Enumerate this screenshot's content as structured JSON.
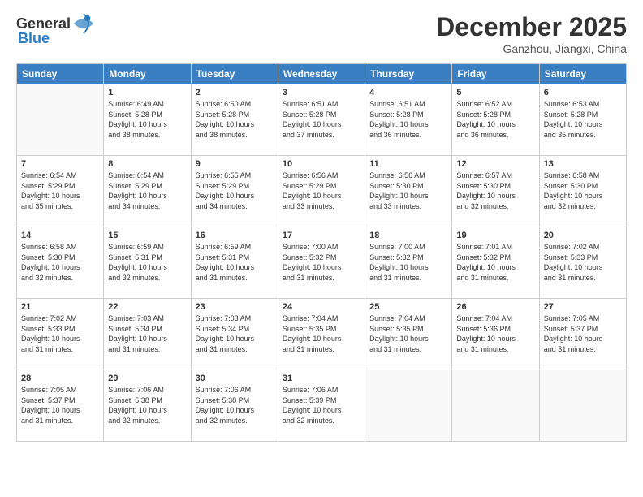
{
  "header": {
    "logo_general": "General",
    "logo_blue": "Blue",
    "month": "December 2025",
    "location": "Ganzhou, Jiangxi, China"
  },
  "days_of_week": [
    "Sunday",
    "Monday",
    "Tuesday",
    "Wednesday",
    "Thursday",
    "Friday",
    "Saturday"
  ],
  "weeks": [
    [
      {
        "day": "",
        "info": ""
      },
      {
        "day": "1",
        "info": "Sunrise: 6:49 AM\nSunset: 5:28 PM\nDaylight: 10 hours\nand 38 minutes."
      },
      {
        "day": "2",
        "info": "Sunrise: 6:50 AM\nSunset: 5:28 PM\nDaylight: 10 hours\nand 38 minutes."
      },
      {
        "day": "3",
        "info": "Sunrise: 6:51 AM\nSunset: 5:28 PM\nDaylight: 10 hours\nand 37 minutes."
      },
      {
        "day": "4",
        "info": "Sunrise: 6:51 AM\nSunset: 5:28 PM\nDaylight: 10 hours\nand 36 minutes."
      },
      {
        "day": "5",
        "info": "Sunrise: 6:52 AM\nSunset: 5:28 PM\nDaylight: 10 hours\nand 36 minutes."
      },
      {
        "day": "6",
        "info": "Sunrise: 6:53 AM\nSunset: 5:28 PM\nDaylight: 10 hours\nand 35 minutes."
      }
    ],
    [
      {
        "day": "7",
        "info": "Sunrise: 6:54 AM\nSunset: 5:29 PM\nDaylight: 10 hours\nand 35 minutes."
      },
      {
        "day": "8",
        "info": "Sunrise: 6:54 AM\nSunset: 5:29 PM\nDaylight: 10 hours\nand 34 minutes."
      },
      {
        "day": "9",
        "info": "Sunrise: 6:55 AM\nSunset: 5:29 PM\nDaylight: 10 hours\nand 34 minutes."
      },
      {
        "day": "10",
        "info": "Sunrise: 6:56 AM\nSunset: 5:29 PM\nDaylight: 10 hours\nand 33 minutes."
      },
      {
        "day": "11",
        "info": "Sunrise: 6:56 AM\nSunset: 5:30 PM\nDaylight: 10 hours\nand 33 minutes."
      },
      {
        "day": "12",
        "info": "Sunrise: 6:57 AM\nSunset: 5:30 PM\nDaylight: 10 hours\nand 32 minutes."
      },
      {
        "day": "13",
        "info": "Sunrise: 6:58 AM\nSunset: 5:30 PM\nDaylight: 10 hours\nand 32 minutes."
      }
    ],
    [
      {
        "day": "14",
        "info": "Sunrise: 6:58 AM\nSunset: 5:30 PM\nDaylight: 10 hours\nand 32 minutes."
      },
      {
        "day": "15",
        "info": "Sunrise: 6:59 AM\nSunset: 5:31 PM\nDaylight: 10 hours\nand 32 minutes."
      },
      {
        "day": "16",
        "info": "Sunrise: 6:59 AM\nSunset: 5:31 PM\nDaylight: 10 hours\nand 31 minutes."
      },
      {
        "day": "17",
        "info": "Sunrise: 7:00 AM\nSunset: 5:32 PM\nDaylight: 10 hours\nand 31 minutes."
      },
      {
        "day": "18",
        "info": "Sunrise: 7:00 AM\nSunset: 5:32 PM\nDaylight: 10 hours\nand 31 minutes."
      },
      {
        "day": "19",
        "info": "Sunrise: 7:01 AM\nSunset: 5:32 PM\nDaylight: 10 hours\nand 31 minutes."
      },
      {
        "day": "20",
        "info": "Sunrise: 7:02 AM\nSunset: 5:33 PM\nDaylight: 10 hours\nand 31 minutes."
      }
    ],
    [
      {
        "day": "21",
        "info": "Sunrise: 7:02 AM\nSunset: 5:33 PM\nDaylight: 10 hours\nand 31 minutes."
      },
      {
        "day": "22",
        "info": "Sunrise: 7:03 AM\nSunset: 5:34 PM\nDaylight: 10 hours\nand 31 minutes."
      },
      {
        "day": "23",
        "info": "Sunrise: 7:03 AM\nSunset: 5:34 PM\nDaylight: 10 hours\nand 31 minutes."
      },
      {
        "day": "24",
        "info": "Sunrise: 7:04 AM\nSunset: 5:35 PM\nDaylight: 10 hours\nand 31 minutes."
      },
      {
        "day": "25",
        "info": "Sunrise: 7:04 AM\nSunset: 5:35 PM\nDaylight: 10 hours\nand 31 minutes."
      },
      {
        "day": "26",
        "info": "Sunrise: 7:04 AM\nSunset: 5:36 PM\nDaylight: 10 hours\nand 31 minutes."
      },
      {
        "day": "27",
        "info": "Sunrise: 7:05 AM\nSunset: 5:37 PM\nDaylight: 10 hours\nand 31 minutes."
      }
    ],
    [
      {
        "day": "28",
        "info": "Sunrise: 7:05 AM\nSunset: 5:37 PM\nDaylight: 10 hours\nand 31 minutes."
      },
      {
        "day": "29",
        "info": "Sunrise: 7:06 AM\nSunset: 5:38 PM\nDaylight: 10 hours\nand 32 minutes."
      },
      {
        "day": "30",
        "info": "Sunrise: 7:06 AM\nSunset: 5:38 PM\nDaylight: 10 hours\nand 32 minutes."
      },
      {
        "day": "31",
        "info": "Sunrise: 7:06 AM\nSunset: 5:39 PM\nDaylight: 10 hours\nand 32 minutes."
      },
      {
        "day": "",
        "info": ""
      },
      {
        "day": "",
        "info": ""
      },
      {
        "day": "",
        "info": ""
      }
    ]
  ]
}
